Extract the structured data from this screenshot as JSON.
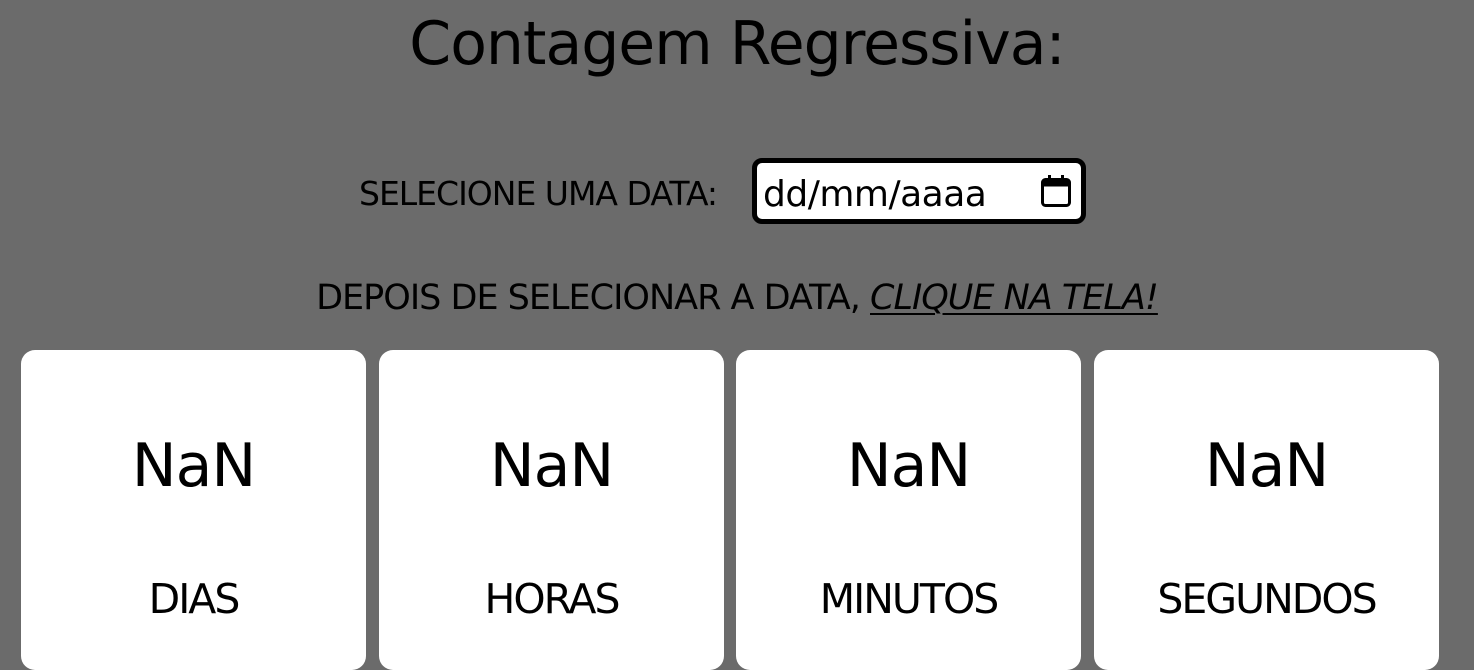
{
  "title": "Contagem Regressiva:",
  "date_picker": {
    "label": "SELECIONE UMA DATA:",
    "placeholder": "dd/mm/aaaa",
    "icon": "calendar-icon"
  },
  "hint": {
    "prefix": "DEPOIS DE SELECIONAR A DATA, ",
    "emphasis": "CLIQUE NA TELA!"
  },
  "countdown": [
    {
      "value": "NaN",
      "label": "DIAS"
    },
    {
      "value": "NaN",
      "label": "HORAS"
    },
    {
      "value": "NaN",
      "label": "MINUTOS"
    },
    {
      "value": "NaN",
      "label": "SEGUNDOS"
    }
  ],
  "colors": {
    "background": "#6b6b6b",
    "card": "#ffffff",
    "text": "#000000"
  }
}
